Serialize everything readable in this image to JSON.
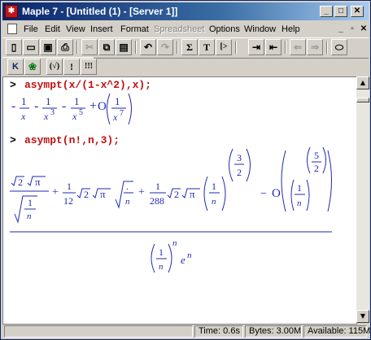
{
  "window": {
    "app_icon": "maple-leaf-icon",
    "title": "Maple 7 - [Untitled (1) - [Server 1]]",
    "caption_buttons": [
      "_",
      "□",
      "✕"
    ]
  },
  "menubar": {
    "items": [
      {
        "label": "File",
        "enabled": true
      },
      {
        "label": "Edit",
        "enabled": true
      },
      {
        "label": "View",
        "enabled": true
      },
      {
        "label": "Insert",
        "enabled": true
      },
      {
        "label": "Format",
        "enabled": true
      },
      {
        "label": "Spreadsheet",
        "enabled": false
      },
      {
        "label": "Options",
        "enabled": true
      },
      {
        "label": "Window",
        "enabled": true
      },
      {
        "label": "Help",
        "enabled": true
      }
    ],
    "mdi_buttons": [
      "_",
      "▫",
      "✕"
    ]
  },
  "toolbar": {
    "buttons": [
      {
        "icon": "new-document-icon",
        "glyph": "▯"
      },
      {
        "icon": "open-folder-icon",
        "glyph": "▭"
      },
      {
        "icon": "save-icon",
        "glyph": "▣"
      },
      {
        "icon": "print-icon",
        "glyph": "⎙"
      },
      {
        "icon": "cut-icon",
        "glyph": "✂"
      },
      {
        "icon": "copy-icon",
        "glyph": "⧉"
      },
      {
        "icon": "paste-icon",
        "glyph": "▤"
      },
      {
        "icon": "undo-icon",
        "glyph": "↶"
      },
      {
        "icon": "redo-icon",
        "glyph": "↷"
      },
      {
        "icon": "sigma-icon",
        "glyph": "Σ"
      },
      {
        "icon": "text-icon",
        "glyph": "T"
      },
      {
        "icon": "maple-input-icon",
        "glyph": "[>"
      },
      {
        "icon": "indent-icon",
        "glyph": "⇥"
      },
      {
        "icon": "outdent-icon",
        "glyph": "⇤"
      },
      {
        "icon": "back-icon",
        "glyph": "⇐"
      },
      {
        "icon": "forward-icon",
        "glyph": "⇒"
      },
      {
        "icon": "stop-icon",
        "glyph": "⬭"
      }
    ]
  },
  "context_toolbar": {
    "buttons": [
      {
        "icon": "maple-k-icon",
        "glyph": "K"
      },
      {
        "icon": "maple-leaf-green-icon",
        "glyph": "❀"
      },
      {
        "icon": "evaluate-icon",
        "glyph": "(√)"
      },
      {
        "icon": "execute-icon",
        "glyph": "!"
      },
      {
        "icon": "execute-all-icon",
        "glyph": "!!!"
      }
    ]
  },
  "worksheet": {
    "prompt_symbol": ">",
    "input1": "asympt(x/(1-x^2),x);",
    "input2": "asympt(n!,n,3);",
    "output1": {
      "terms": [
        "1",
        "x",
        "1",
        "x",
        "3",
        "1",
        "x",
        "5",
        "O",
        "1",
        "x",
        "7"
      ],
      "operators": [
        "-",
        "-",
        "-",
        "+"
      ]
    },
    "output2": {
      "sqrt2": "2",
      "pi": "π",
      "coef1": "1",
      "coef1_den": "12",
      "coef2": "1",
      "coef2_den": "288",
      "n": "n",
      "one": "1",
      "three": "3",
      "two": "2",
      "five": "5",
      "plus": "+",
      "minus": "−",
      "O": "O",
      "dot": ".",
      "e": "e"
    }
  },
  "statusbar": {
    "time_label": "Time: 0.6s",
    "bytes_label": "Bytes: 3.00M",
    "available_label": "Available: 115M"
  }
}
